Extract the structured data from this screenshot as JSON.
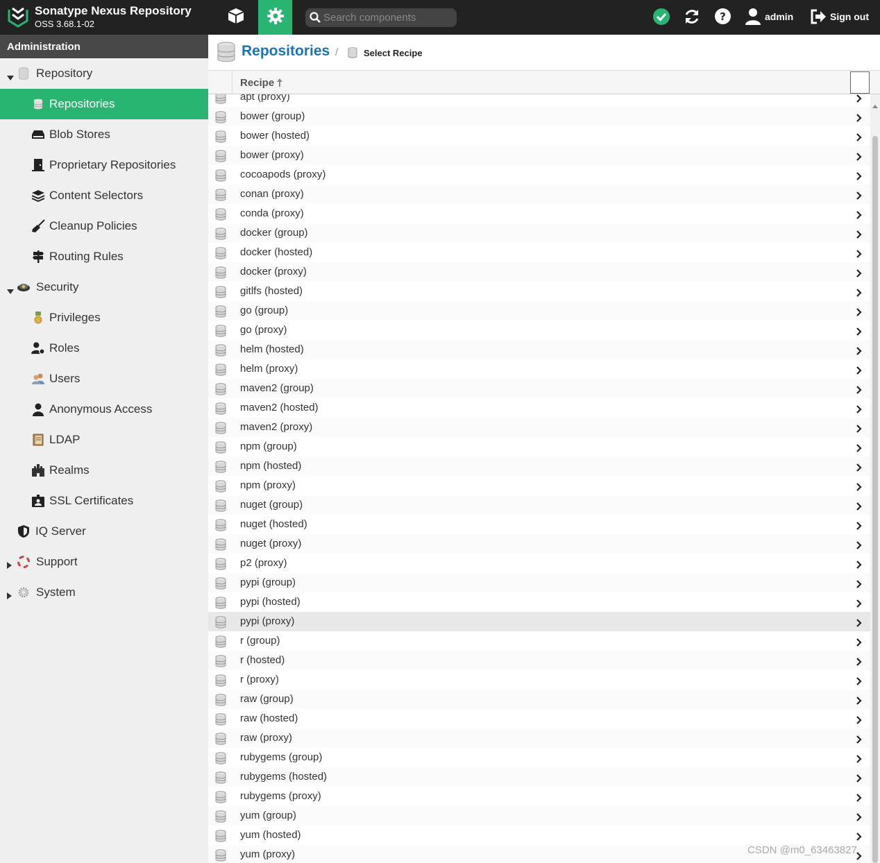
{
  "header": {
    "brand_title": "Sonatype Nexus Repository",
    "brand_version": "OSS 3.68.1-02",
    "search_placeholder": "Search components",
    "user_label": "admin",
    "signout_label": "Sign out",
    "accent_color": "#29b472"
  },
  "sidebar": {
    "title": "Administration",
    "items": [
      {
        "label": "Repository",
        "icon": "database-icon",
        "expanded": true
      },
      {
        "label": "Repositories",
        "icon": "database-icon",
        "active": true
      },
      {
        "label": "Blob Stores",
        "icon": "drive-icon"
      },
      {
        "label": "Proprietary Repositories",
        "icon": "door-icon"
      },
      {
        "label": "Content Selectors",
        "icon": "layers-icon"
      },
      {
        "label": "Cleanup Policies",
        "icon": "broom-icon"
      },
      {
        "label": "Routing Rules",
        "icon": "signpost-icon"
      },
      {
        "label": "Security",
        "icon": "police-badge-icon",
        "expanded": true
      },
      {
        "label": "Privileges",
        "icon": "medal-icon"
      },
      {
        "label": "Roles",
        "icon": "user-role-icon"
      },
      {
        "label": "Users",
        "icon": "users-icon"
      },
      {
        "label": "Anonymous Access",
        "icon": "user-icon"
      },
      {
        "label": "LDAP",
        "icon": "book-icon"
      },
      {
        "label": "Realms",
        "icon": "castle-icon"
      },
      {
        "label": "SSL Certificates",
        "icon": "certificate-icon"
      },
      {
        "label": "IQ Server",
        "icon": "shield-icon"
      },
      {
        "label": "Support",
        "icon": "lifebuoy-icon",
        "expanded": false
      },
      {
        "label": "System",
        "icon": "gear-icon",
        "expanded": false
      }
    ]
  },
  "breadcrumb": {
    "title": "Repositories",
    "separator": "/",
    "current": "Select Recipe"
  },
  "grid": {
    "column_header": "Recipe",
    "rows": [
      "apt (proxy)",
      "bower (group)",
      "bower (hosted)",
      "bower (proxy)",
      "cocoapods (proxy)",
      "conan (proxy)",
      "conda (proxy)",
      "docker (group)",
      "docker (hosted)",
      "docker (proxy)",
      "gitlfs (hosted)",
      "go (group)",
      "go (proxy)",
      "helm (hosted)",
      "helm (proxy)",
      "maven2 (group)",
      "maven2 (hosted)",
      "maven2 (proxy)",
      "npm (group)",
      "npm (hosted)",
      "npm (proxy)",
      "nuget (group)",
      "nuget (hosted)",
      "nuget (proxy)",
      "p2 (proxy)",
      "pypi (group)",
      "pypi (hosted)",
      "pypi (proxy)",
      "r (group)",
      "r (hosted)",
      "r (proxy)",
      "raw (group)",
      "raw (hosted)",
      "raw (proxy)",
      "rubygems (group)",
      "rubygems (hosted)",
      "rubygems (proxy)",
      "yum (group)",
      "yum (hosted)",
      "yum (proxy)"
    ],
    "hovered_row": "pypi (proxy)"
  },
  "watermark": "CSDN @m0_63463827"
}
